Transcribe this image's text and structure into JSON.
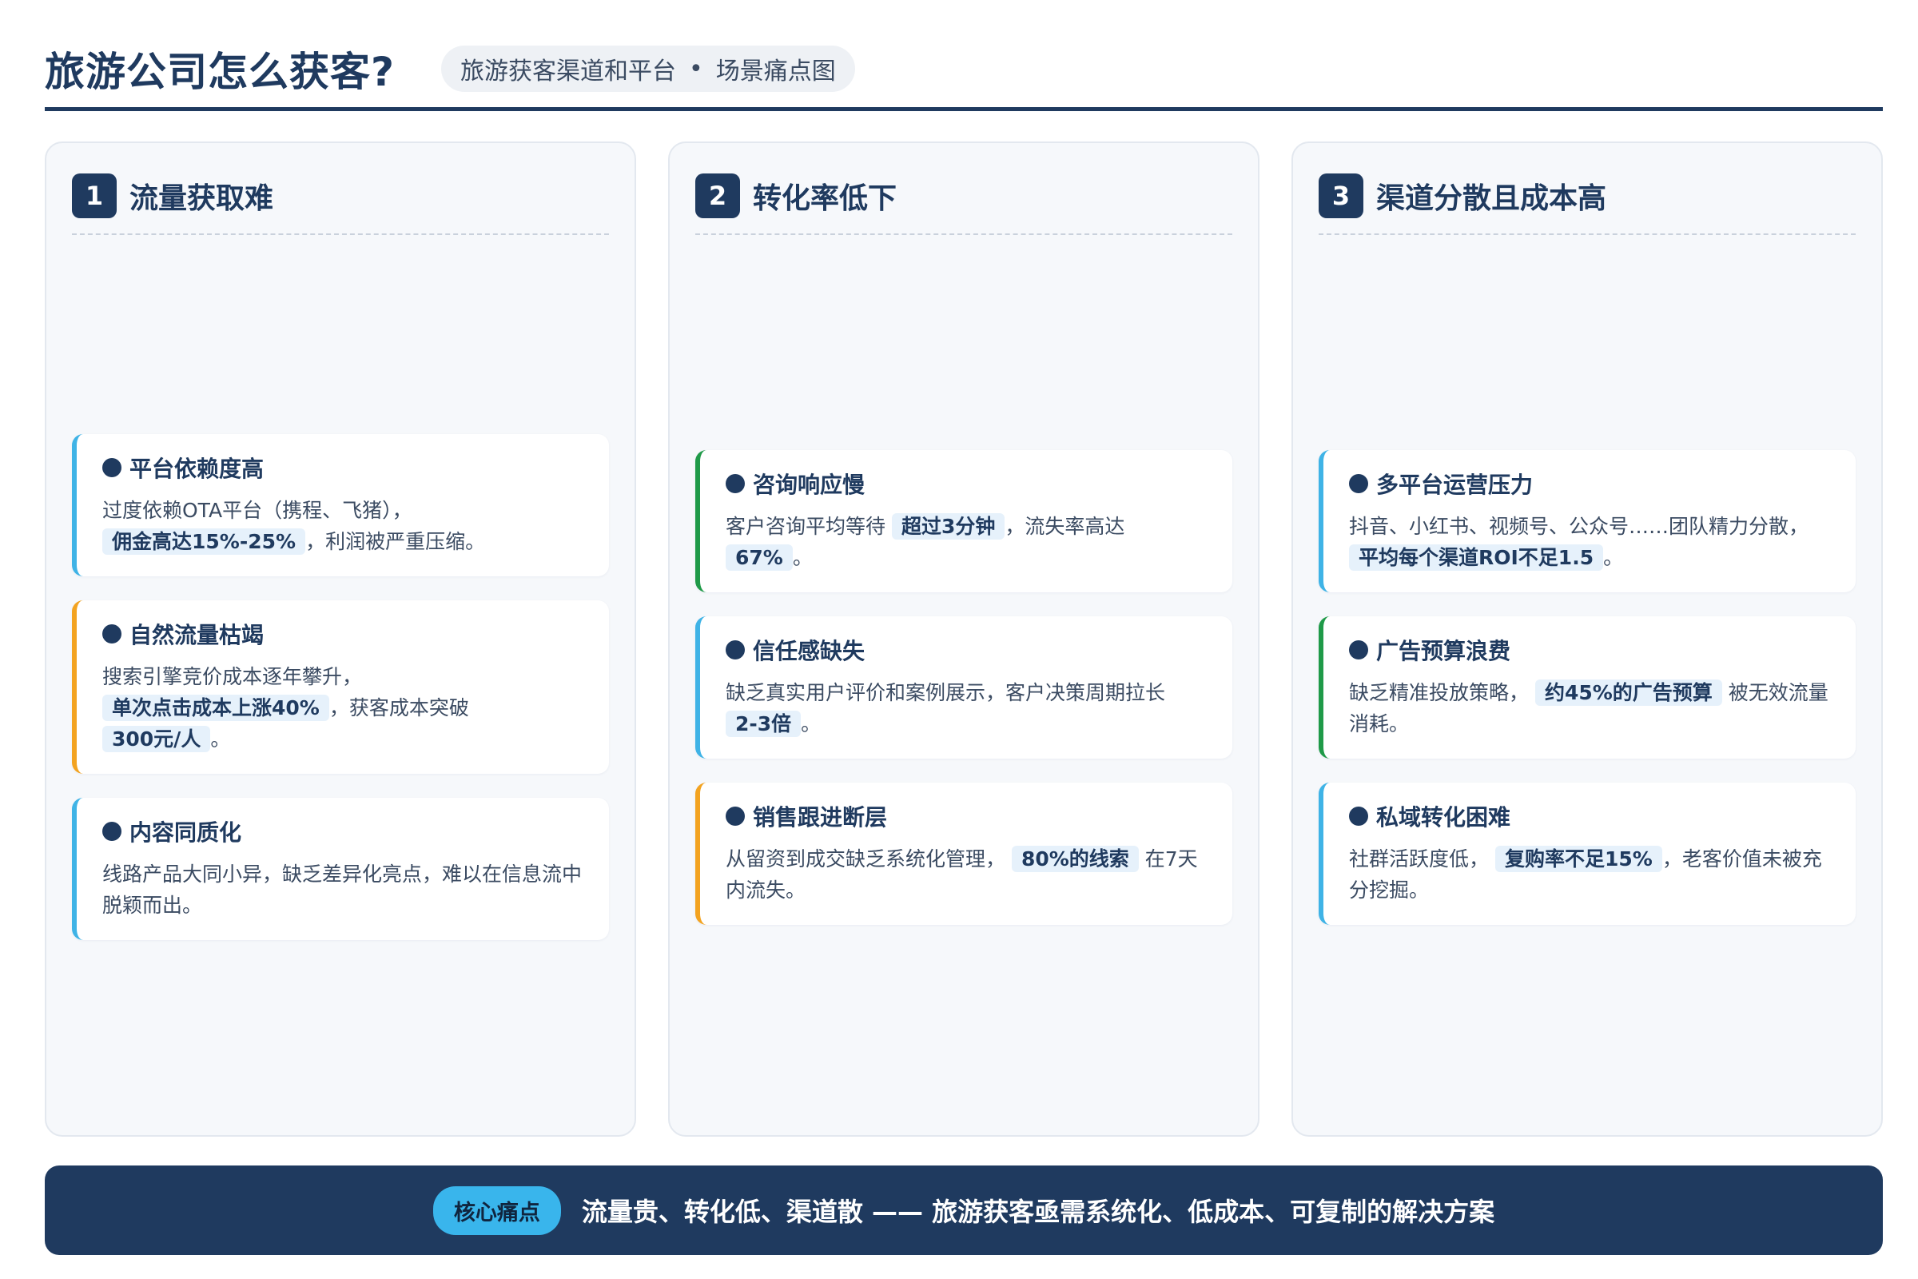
{
  "header": {
    "title": "旅游公司怎么获客?",
    "subtitle_left": "旅游获客渠道和平台",
    "subtitle_sep": "•",
    "subtitle_right": "场景痛点图"
  },
  "columns": [
    {
      "num": "1",
      "title": "流量获取难",
      "cards": [
        {
          "title": "平台依赖度高",
          "pre": "过度依赖OTA平台（携程、飞猪），",
          "hl": "佣金高达15%-25%",
          "post": "，利润被严重压缩。",
          "hl2": "",
          "post2": ""
        },
        {
          "title": "自然流量枯竭",
          "pre": "搜索引擎竞价成本逐年攀升，",
          "hl": "单次点击成本上涨40%",
          "post": "，获客成本突破",
          "hl2": "300元/人",
          "post2": "。"
        },
        {
          "title": "内容同质化",
          "pre": "线路产品大同小异，缺乏差异化亮点，难以在信息流中脱颖而出。",
          "hl": "",
          "post": "",
          "hl2": "",
          "post2": ""
        }
      ]
    },
    {
      "num": "2",
      "title": "转化率低下",
      "cards": [
        {
          "title": "咨询响应慢",
          "pre": "客户咨询平均等待",
          "hl": "超过3分钟",
          "post": "，流失率高达",
          "hl2": "67%",
          "post2": "。"
        },
        {
          "title": "信任感缺失",
          "pre": "缺乏真实用户评价和案例展示，客户决策周期拉长",
          "hl": "2-3倍",
          "post": "。",
          "hl2": "",
          "post2": ""
        },
        {
          "title": "销售跟进断层",
          "pre": "从留资到成交缺乏系统化管理，",
          "hl": "80%的线索",
          "post": "在7天内流失。",
          "hl2": "",
          "post2": ""
        }
      ]
    },
    {
      "num": "3",
      "title": "渠道分散且成本高",
      "cards": [
        {
          "title": "多平台运营压力",
          "pre": "抖音、小红书、视频号、公众号……团队精力分散，",
          "hl": "平均每个渠道ROI不足1.5",
          "post": "。",
          "hl2": "",
          "post2": ""
        },
        {
          "title": "广告预算浪费",
          "pre": "缺乏精准投放策略，",
          "hl": "约45%的广告预算",
          "post": "被无效流量消耗。",
          "hl2": "",
          "post2": ""
        },
        {
          "title": "私域转化困难",
          "pre": "社群活跃度低，",
          "hl": "复购率不足15%",
          "post": "，老客价值未被充分挖掘。",
          "hl2": "",
          "post2": ""
        }
      ]
    }
  ],
  "banner": {
    "tag": "核心痛点",
    "text": "流量贵、转化低、渠道散 —— 旅游获客亟需系统化、低成本、可复制的解决方案"
  },
  "colors": {
    "navy": "#1f3a5f",
    "accent_blue": "#3fb3e6",
    "accent_orange": "#f3a320",
    "accent_green": "#1f9a48",
    "highlight_bg": "#e6f1fb"
  }
}
